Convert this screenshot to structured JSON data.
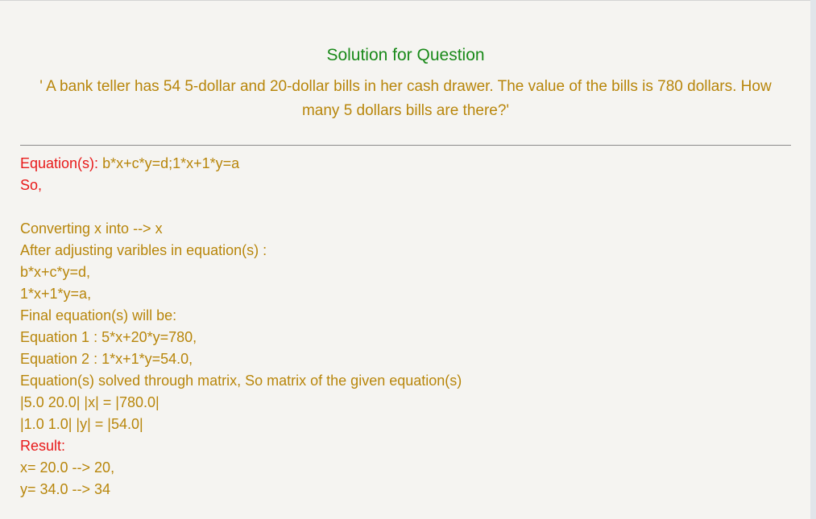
{
  "page": {
    "title": "Solution for Question",
    "question": "' A bank teller has 54 5-dollar and 20-dollar bills in her cash drawer. The value of the bills is 780 dollars. How many 5 dollars bills are there?'"
  },
  "solution": {
    "equations_label": "Equation(s):",
    "equations_value": " b*x+c*y=d;1*x+1*y=a",
    "so_label": "So,",
    "converting": "Converting x into --> x",
    "after_adjusting": "After adjusting varibles in equation(s) :",
    "adjusted_1": "b*x+c*y=d,",
    "adjusted_2": "1*x+1*y=a,",
    "final_label": "Final equation(s) will be:",
    "equation_1": "Equation 1 : 5*x+20*y=780,",
    "equation_2": "Equation 2 : 1*x+1*y=54.0,",
    "matrix_label": "Equation(s) solved through matrix, So matrix of the given equation(s)",
    "matrix_row_1": "|5.0 20.0| |x| = |780.0|",
    "matrix_row_2": "|1.0 1.0| |y| = |54.0|",
    "result_label": "Result:",
    "result_x": "x= 20.0 --> 20,",
    "result_y": "y= 34.0 --> 34"
  }
}
